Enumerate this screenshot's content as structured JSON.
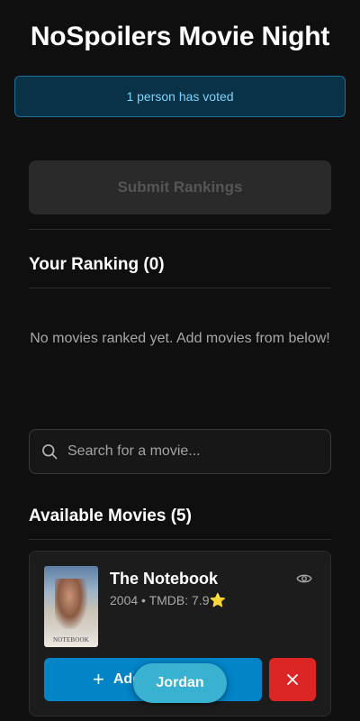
{
  "app": {
    "title": "NoSpoilers Movie Night"
  },
  "vote_status": {
    "text": "1 person has voted"
  },
  "submit": {
    "label": "Submit Rankings",
    "disabled": true
  },
  "ranking": {
    "heading": "Your Ranking (0)",
    "empty_message": "No movies ranked yet. Add movies from below!"
  },
  "search": {
    "placeholder": "Search for a movie...",
    "value": "",
    "icon": "search-icon"
  },
  "available": {
    "heading": "Available Movies (5)",
    "movies": [
      {
        "title": "The Notebook",
        "meta": "2004 • TMDB: 7.9",
        "rating_icon": "⭐",
        "poster_text": "NOTEBOOK",
        "add_label": "Add",
        "add_icon": "plus-icon",
        "remove_icon": "close-icon",
        "watch_icon": "eye-icon"
      }
    ]
  },
  "user": {
    "name": "Jordan"
  },
  "colors": {
    "background": "#0f0f0f",
    "accent": "#0284c7",
    "danger": "#dc2626",
    "banner_bg": "#0a3247",
    "banner_text": "#7dd3fc",
    "user_pill": "#38b2d0"
  }
}
